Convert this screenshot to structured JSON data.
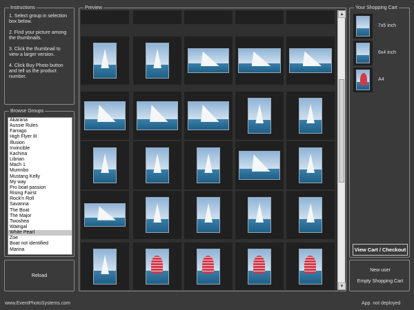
{
  "instructions": {
    "title": "Instructions",
    "steps": [
      "1. Select group in selection box below.",
      "2. Find your picture among the thumbnails.",
      "3. Click the thumbnail to view a larger version.",
      "4. Click Buy Photo button and tell us the product number."
    ]
  },
  "browse": {
    "title": "Browse Groups",
    "selected_index": 20,
    "groups": [
      "Akarana",
      "Aussie Rules",
      "Farrago",
      "High Flyer III",
      "Illusion",
      "Invincible",
      "Kachina",
      "Librian",
      "Mach 1",
      "Mumnbo",
      "Mustang Kelly",
      "My way",
      "Pro boat passion",
      "Rising Fairst",
      "Rock'n Roll",
      "Savanna",
      "The Boat",
      "The Major",
      "Twoshea",
      "Wairigal",
      "White Pearl",
      "Zoe",
      "Boat not identified",
      "Marina"
    ]
  },
  "reload_label": "Reload",
  "preview": {
    "title": "Preview"
  },
  "cart": {
    "title": "Your Shopping Cart",
    "items": [
      {
        "label": "7x5 inch",
        "sail_color": "#e8eef5"
      },
      {
        "label": "6x4 inch",
        "sail_color": "#e8eef5"
      },
      {
        "label": "A4",
        "sail_color": "#d23a4a"
      }
    ],
    "checkout_label": "View Cart / Checkout"
  },
  "user": {
    "new_user_label": "New user",
    "empty_cart_label": "Empty Shopping Cart"
  },
  "footer": {
    "site": "www.EventPhotoSystems.com",
    "status": "App. not deployed"
  },
  "colors": {
    "panel_bg": "#3a3a3a",
    "thumb_frame": "#202020",
    "red_sail": "#d23a4a"
  }
}
